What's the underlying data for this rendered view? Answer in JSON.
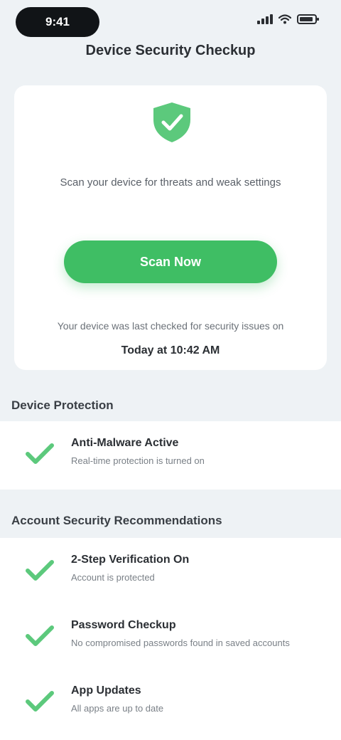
{
  "status_bar": {
    "time": "9:41"
  },
  "nav": {
    "title": "Device Security Checkup"
  },
  "hero": {
    "icon": "shield-check-icon",
    "description": "Scan your device for threats and weak settings",
    "scan_button": "Scan Now",
    "last_scan_note": "Your device was last checked for security issues on",
    "last_scan_date": "Today at 10:42 AM"
  },
  "sections": [
    {
      "header": "Device Protection",
      "items": [
        {
          "title": "Anti-Malware Active",
          "subtitle": "Real-time protection is turned on"
        }
      ]
    },
    {
      "header": "Account Security Recommendations",
      "items": [
        {
          "title": "2-Step Verification On",
          "subtitle": "Account is protected"
        },
        {
          "title": "Password Checkup",
          "subtitle": "No compromised passwords found in saved accounts"
        },
        {
          "title": "App Updates",
          "subtitle": "All apps are up to date"
        }
      ]
    }
  ],
  "colors": {
    "accent": "#3fbe64",
    "background": "#eef2f5",
    "card": "#ffffff"
  }
}
